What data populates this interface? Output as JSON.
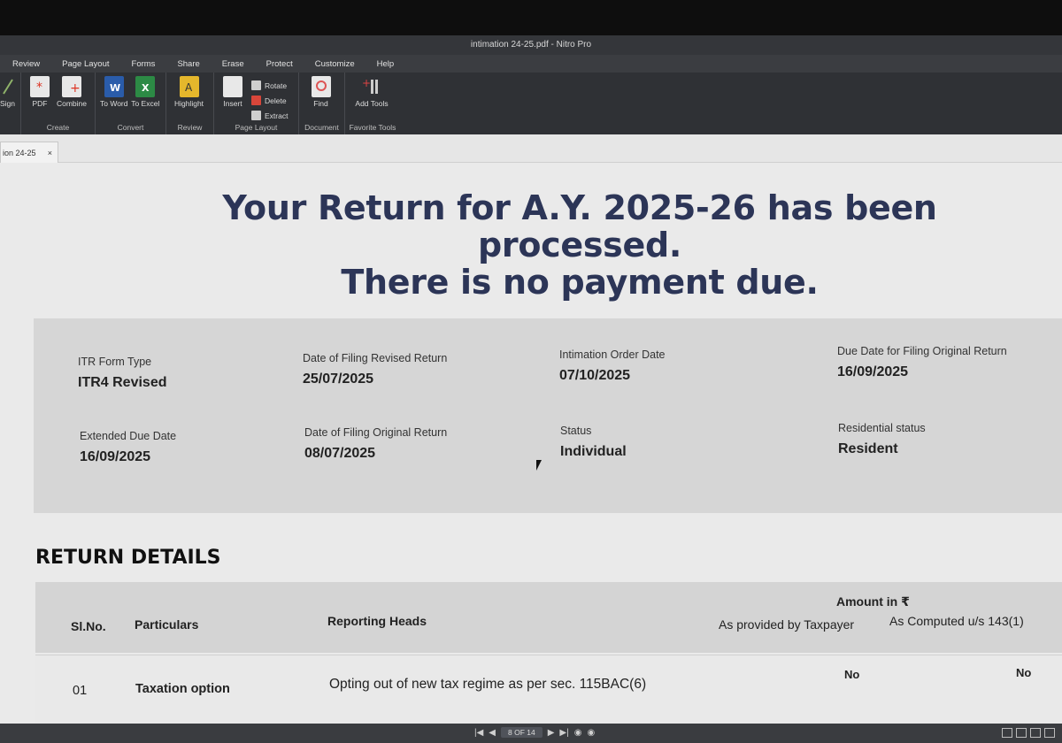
{
  "window": {
    "title": "intimation 24-25.pdf - Nitro Pro"
  },
  "menu": [
    "Review",
    "Page Layout",
    "Forms",
    "Share",
    "Erase",
    "Protect",
    "Customize",
    "Help"
  ],
  "ribbon": {
    "sign": "Sign",
    "create": {
      "label": "Create",
      "pdf": "PDF",
      "combine": "Combine"
    },
    "convert": {
      "label": "Convert",
      "to_word": "To Word",
      "to_excel": "To Excel"
    },
    "review": {
      "label": "Review",
      "highlight": "Highlight"
    },
    "page_layout": {
      "label": "Page Layout",
      "insert": "Insert",
      "rotate": "Rotate",
      "delete": "Delete",
      "extract": "Extract"
    },
    "document": {
      "label": "Document",
      "find": "Find"
    },
    "favorite": {
      "label": "Favorite Tools",
      "add_tools": "Add Tools"
    }
  },
  "tab": {
    "label": "ion 24-25",
    "close": "×"
  },
  "doc": {
    "headline_line1": "Your Return for A.Y. 2025-26 has been processed.",
    "headline_line2": "There is no payment due.",
    "fields": {
      "itr_form_type": {
        "label": "ITR Form Type",
        "value": "ITR4 Revised"
      },
      "date_revised": {
        "label": "Date of Filing Revised Return",
        "value": "25/07/2025"
      },
      "intimation_date": {
        "label": "Intimation Order Date",
        "value": "07/10/2025"
      },
      "due_original": {
        "label": "Due Date for Filing Original Return",
        "value": "16/09/2025"
      },
      "extended_due": {
        "label": "Extended Due Date",
        "value": "16/09/2025"
      },
      "date_original": {
        "label": "Date of Filing Original Return",
        "value": "08/07/2025"
      },
      "status": {
        "label": "Status",
        "value": "Individual"
      },
      "residential": {
        "label": "Residential status",
        "value": "Resident"
      }
    },
    "section_title": "RETURN DETAILS",
    "table": {
      "headers": {
        "slno": "Sl.No.",
        "particulars": "Particulars",
        "reporting": "Reporting Heads",
        "amount": "Amount in ₹",
        "taxpayer": "As provided by Taxpayer",
        "computed": "As Computed u/s 143(1)"
      },
      "rows": [
        {
          "slno": "01",
          "particulars": "Taxation option",
          "reporting": "Opting out of new tax regime as per sec. 115BAC(6)",
          "taxpayer": "No",
          "computed": "No"
        }
      ]
    }
  },
  "status": {
    "page": "8 OF 14"
  },
  "colors": {
    "headline": "#2c3557",
    "ribbon": "#2f3135",
    "page": "#eaeaea",
    "panel": "#d6d6d6"
  }
}
